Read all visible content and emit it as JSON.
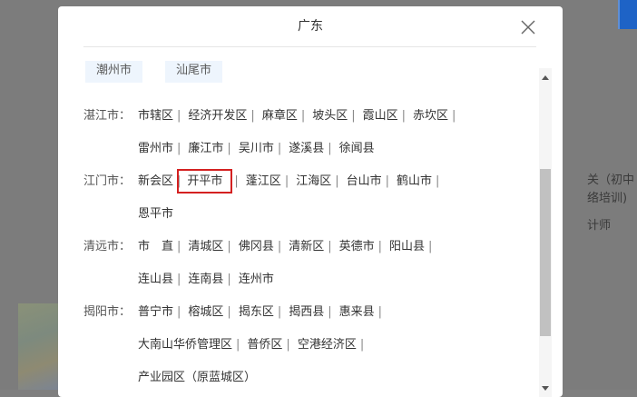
{
  "modal": {
    "title": "广东"
  },
  "partial_chips": [
    "潮州市",
    "汕尾市"
  ],
  "rows": [
    {
      "label": "湛江市：",
      "items": [
        "市辖区",
        "经济开发区",
        "麻章区",
        "坡头区",
        "霞山区",
        "赤坎区"
      ],
      "trailing_sep": true
    },
    {
      "label": "",
      "items": [
        "雷州市",
        "廉江市",
        "吴川市",
        "遂溪县",
        "徐闻县"
      ],
      "trailing_sep": false
    },
    {
      "label": "江门市：",
      "items": [
        "新会区",
        "开平市",
        "蓬江区",
        "江海区",
        "台山市",
        "鹤山市"
      ],
      "trailing_sep": true,
      "highlight": "开平市"
    },
    {
      "label": "",
      "items": [
        "恩平市"
      ],
      "trailing_sep": false
    },
    {
      "label": "清远市：",
      "items": [
        "市　直",
        "清城区",
        "佛冈县",
        "清新区",
        "英德市",
        "阳山县"
      ],
      "trailing_sep": true
    },
    {
      "label": "",
      "items": [
        "连山县",
        "连南县",
        "连州市"
      ],
      "trailing_sep": false
    },
    {
      "label": "揭阳市：",
      "items": [
        "普宁市",
        "榕城区",
        "揭东区",
        "揭西县",
        "惠来县"
      ],
      "trailing_sep": true
    },
    {
      "label": "",
      "items": [
        "大南山华侨管理区",
        "普侨区",
        "空港经济区"
      ],
      "trailing_sep": true
    },
    {
      "label": "",
      "items": [
        "产业园区（原蓝城区）"
      ],
      "trailing_sep": false
    }
  ],
  "background": {
    "text_lines": [
      "关（初中",
      "络培训)",
      "计师"
    ]
  },
  "colors": {
    "highlight_border": "#d42121",
    "chip_bg": "#eef5fd",
    "overlay": "#7f7f7f",
    "bg_accent": "#1e63c6"
  }
}
